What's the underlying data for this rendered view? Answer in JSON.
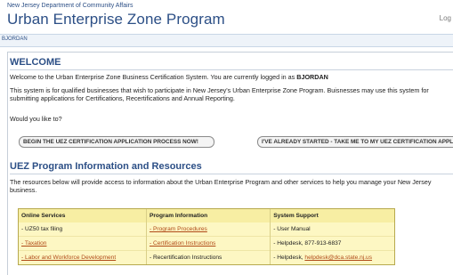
{
  "header": {
    "dept": "New Jersey Department of Community Affairs",
    "title": "Urban Enterprise Zone Program",
    "login": "Log"
  },
  "userbar": {
    "user": "BJORDAN"
  },
  "welcome": {
    "heading": "WELCOME",
    "intro_prefix": "Welcome to the Urban Enterprise Zone Business Certification System. You are currently logged in as ",
    "intro_user": "BJORDAN",
    "desc": "This system is for qualified businesses that wish to participate in New Jersey's Urban Enterprise Zone Program. Buisnesses may use this system for submitting applications for Certifications, Recertifications and Annual Reporting.",
    "question": "Would you like to?",
    "btn_begin": "BEGIN THE UEZ CERTIFICATION APPLICATION PROCESS NOW!",
    "btn_started": "I'VE ALREADY STARTED - TAKE ME TO MY UEZ CERTIFICATION APPLICATION"
  },
  "resources": {
    "heading": "UEZ Program Information and Resources",
    "desc": "The resources below will provide access to information about the Urban Enterprise Program and other services to help you manage your New Jersey business.",
    "columns": [
      "Online Services",
      "Program Information",
      "System Support"
    ],
    "rows": [
      [
        {
          "t": "- UZ50 tax filing",
          "link": false
        },
        {
          "t": "- Program Procedures",
          "link": true
        },
        {
          "t": "- User Manual",
          "link": false
        }
      ],
      [
        {
          "t": "- Taxation",
          "link": true
        },
        {
          "t": "- Certification Instructions",
          "link": true
        },
        {
          "t": "- Helpdesk, 877-913-6837",
          "link": false
        }
      ],
      [
        {
          "t": "- Labor and Workforce Development",
          "link": true
        },
        {
          "t": "- Recertification Instructions",
          "link": false
        },
        {
          "t": "- Helpdesk, ",
          "link": false,
          "extra": "helpdesk@dca.state.nj.us"
        }
      ]
    ]
  }
}
